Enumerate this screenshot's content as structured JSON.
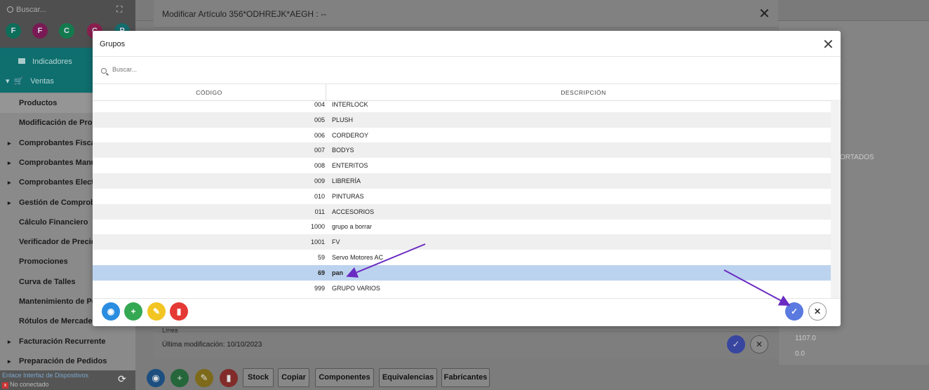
{
  "sidebar": {
    "search_placeholder": "Buscar...",
    "circles": [
      "F",
      "F",
      "C",
      "C",
      "P"
    ],
    "circle_colors": [
      "#0d6e5a",
      "#7a1a55",
      "#137a4e",
      "#8a1f4f",
      "#156d6d"
    ],
    "sections": [
      {
        "label": "Indicadores",
        "icon": "dashboard-icon"
      },
      {
        "label": "Ventas",
        "icon": "cart-icon"
      }
    ],
    "items": [
      {
        "label": "Productos",
        "caret": false
      },
      {
        "label": "Modificación de Prod",
        "caret": false
      },
      {
        "label": "Comprobantes Fiscal",
        "caret": true
      },
      {
        "label": "Comprobantes Manu",
        "caret": true
      },
      {
        "label": "Comprobantes Electr",
        "caret": true
      },
      {
        "label": "Gestión de Comproba",
        "caret": true
      },
      {
        "label": "Cálculo Financiero",
        "caret": false
      },
      {
        "label": "Verificador de Precio",
        "caret": false
      },
      {
        "label": "Promociones",
        "caret": false
      },
      {
        "label": "Curva de Talles",
        "caret": false
      },
      {
        "label": "Mantenimiento de Pe",
        "caret": false
      },
      {
        "label": "Rótulos de Mercaderi",
        "caret": false
      },
      {
        "label": "Facturación Recurrente",
        "caret": true
      },
      {
        "label": "Preparación de Pedidos",
        "caret": true
      }
    ],
    "device_link": "Enlace Interfaz de Dispositivos",
    "connection_status": "No conectado"
  },
  "modify_modal": {
    "title": "Modificar Artículo 356*ODHREJK*AEGH : --",
    "linea_label": "Línea",
    "last_modified": "Última modificación: 10/10/2023"
  },
  "background": {
    "importados": "ORTADOS",
    "value1": "1107.0",
    "value2": "0.0"
  },
  "toolbar": {
    "buttons": [
      "Stock",
      "Copiar",
      "Componentes",
      "Equivalencias",
      "Fabricantes"
    ]
  },
  "dialog": {
    "title": "Grupos",
    "search_placeholder": "Buscar...",
    "col_code": "CÓDIGO",
    "col_desc": "DESCRIPCIÓN",
    "rows": [
      {
        "code": "004",
        "desc": "INTERLOCK"
      },
      {
        "code": "005",
        "desc": "PLUSH"
      },
      {
        "code": "006",
        "desc": "CORDEROY"
      },
      {
        "code": "007",
        "desc": "BODYS"
      },
      {
        "code": "008",
        "desc": "ENTERITOS"
      },
      {
        "code": "009",
        "desc": "LIBRERÍA"
      },
      {
        "code": "010",
        "desc": "PINTURAS"
      },
      {
        "code": "011",
        "desc": "ACCESORIOS"
      },
      {
        "code": "1000",
        "desc": "grupo a borrar"
      },
      {
        "code": "1001",
        "desc": "FV"
      },
      {
        "code": "59",
        "desc": "Servo Motores AC"
      },
      {
        "code": "69",
        "desc": "pan"
      },
      {
        "code": "999",
        "desc": "GRUPO VARIOS"
      }
    ],
    "selected_code": "69",
    "footer_icons": [
      "eye-icon",
      "plus-icon",
      "pencil-icon",
      "trash-icon"
    ],
    "footer_colors": [
      "#2a8de0",
      "#34a853",
      "#f2c522",
      "#e53935"
    ]
  }
}
